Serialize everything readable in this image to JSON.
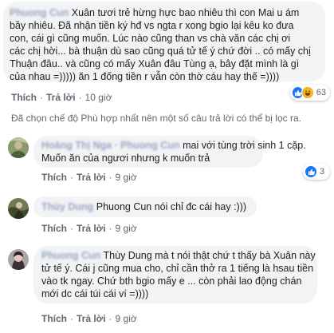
{
  "comment1": {
    "author": "Phuong Cun",
    "lines": [
      "Xuân tươi trẻ hừng hực bao nhiêu thì con Mai u ám",
      "bầy nhiêu. Đã nhận tiền ký hđ vs ngta r xong bgio lại kêu ko đưa",
      "con, cái   gì cũng muốn. Lúc   nào cũng than vs chà văn các chị ơi",
      "các chị hời... bà thuận dù sao cũng quá tử tế ý chứ đời .. có mấy chị",
      "Thuận đâu.. và cũng   có mấy Xuân đâu Tùng ạ, bây đặt mình là gì",
      "của nhau =))))) ăn 1 đống tiền r vẫn còn thờ cáu hay thế =))))"
    ],
    "actions": {
      "like": "Thích",
      "reply": "Trả lời",
      "time": "10 giờ"
    },
    "reactions": {
      "count": "63"
    }
  },
  "filter_notice": "Đã chọn chế độ Phù hợp nhất nên một số câu trả lời có thể bị lọc ra.",
  "comment2": {
    "author": "Hoàng Thị Nga · Phuong Cun",
    "lines": [
      "mai với tùng trời sinh 1 cặp.",
      "Muốn ăn của ngươi nhưng k muốn trả"
    ],
    "actions": {
      "like": "Thích",
      "reply": "Trả lời",
      "time": "9 giờ"
    },
    "reactions": {
      "count": "3"
    }
  },
  "comment3": {
    "author": "Thùy Dung",
    "text": "Phuong Cun nói chỉ đc cái hay :)))",
    "actions": {
      "like": "Thích",
      "reply": "Trả lời",
      "time": "9 giờ"
    }
  },
  "comment4": {
    "author": "Phuong Cun",
    "lines": [
      "Thùy Dung mà t nói thật chứ t thấy bà Xuân này",
      "tử tế ý. Cái j cũng mua cho, chỉ cần thở ra 1 tiếng là hsau tiền",
      "vào tk ngay. Chứ bth bgio mấy e ... còn phải lao động chán",
      "mới dc cái túi cái ví =))))"
    ],
    "actions": {
      "like": "Thích",
      "reply": "Trả lời",
      "time": "9 giờ"
    }
  },
  "colors": {
    "link": "#385898",
    "bubble": "#f2f3f5",
    "meta": "#606770",
    "like_blue": "#1877f2",
    "haha_yellow": "#f7b125"
  }
}
